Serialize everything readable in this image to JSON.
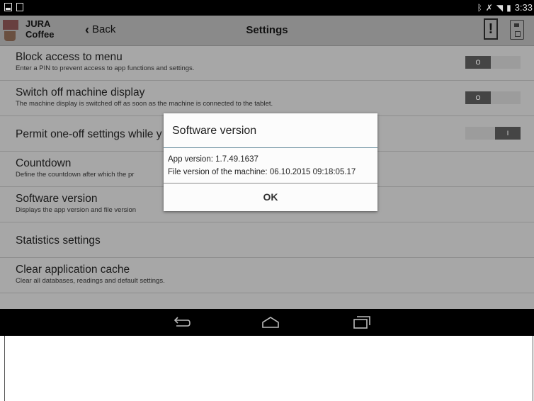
{
  "status_bar": {
    "time": "3:33",
    "left_icons": [
      "notification-icon",
      "document-icon"
    ],
    "right_icons": [
      "bluetooth-icon",
      "mute-icon",
      "wifi-icon",
      "battery-icon"
    ]
  },
  "action_bar": {
    "brand_line1": "JURA",
    "brand_line2": "Coffee",
    "back_label": "Back",
    "title": "Settings",
    "alert_symbol": "!"
  },
  "settings": {
    "items": [
      {
        "title": "Block access to menu",
        "subtitle": "Enter a PIN to prevent access to app functions and settings.",
        "toggle": "O"
      },
      {
        "title": "Switch off machine display",
        "subtitle": "The machine display is switched off as soon as the machine is connected to the tablet.",
        "toggle": "O"
      },
      {
        "title": "Permit one-off settings while y",
        "toggle": "I"
      },
      {
        "title": "Countdown",
        "subtitle": "Define the countdown after which the pr"
      },
      {
        "title": "Software version",
        "subtitle": "Displays the app version and file version"
      },
      {
        "title": "Statistics settings"
      },
      {
        "title": "Clear application cache",
        "subtitle": "Clear all databases, readings and default settings."
      }
    ]
  },
  "dialog": {
    "title": "Software version",
    "app_version": "App version:  1.7.49.1637",
    "file_version": "File version of the machine: 06.10.2015 09:18:05.17",
    "ok_label": "OK"
  },
  "colors": {
    "dimmed_background": "#a7a7a7",
    "action_bar": "#8a8a8a",
    "dialog_separator": "#6b8fa0",
    "toggle_knob": "#454545"
  },
  "nav_bar": {
    "icons": [
      "back-icon",
      "home-icon",
      "recent-apps-icon"
    ]
  }
}
